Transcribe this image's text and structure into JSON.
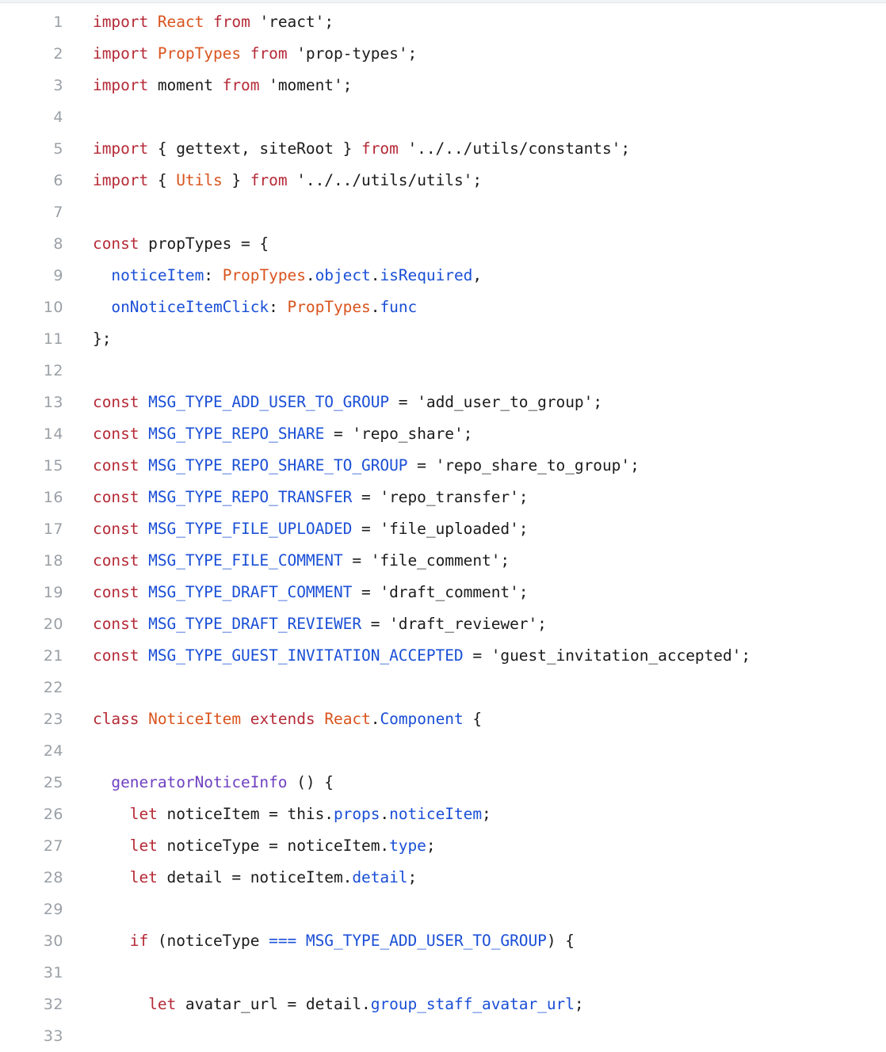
{
  "editor": {
    "language": "javascript",
    "first_line": 1,
    "last_line": 33,
    "total_lines": 33,
    "gutter_color": "#9aa0a6",
    "background_color": "#ffffff",
    "text_color": "#1b1b1b"
  },
  "theme": {
    "keyword": "#b52a37",
    "class_name": "#d9541e",
    "property": "#1a4fd6",
    "function_name": "#6f42c1",
    "string": "#1b1b1b",
    "plain": "#1b1b1b"
  },
  "lines": [
    {
      "n": "1",
      "tokens": [
        {
          "t": "import",
          "c": "tok-kw"
        },
        {
          "t": " ",
          "c": "tok-plain"
        },
        {
          "t": "React",
          "c": "tok-cls"
        },
        {
          "t": " ",
          "c": "tok-plain"
        },
        {
          "t": "from",
          "c": "tok-kw"
        },
        {
          "t": " ",
          "c": "tok-plain"
        },
        {
          "t": "'react'",
          "c": "tok-str"
        },
        {
          "t": ";",
          "c": "tok-punc"
        }
      ]
    },
    {
      "n": "2",
      "tokens": [
        {
          "t": "import",
          "c": "tok-kw"
        },
        {
          "t": " ",
          "c": "tok-plain"
        },
        {
          "t": "PropTypes",
          "c": "tok-cls"
        },
        {
          "t": " ",
          "c": "tok-plain"
        },
        {
          "t": "from",
          "c": "tok-kw"
        },
        {
          "t": " ",
          "c": "tok-plain"
        },
        {
          "t": "'prop-types'",
          "c": "tok-str"
        },
        {
          "t": ";",
          "c": "tok-punc"
        }
      ]
    },
    {
      "n": "3",
      "tokens": [
        {
          "t": "import",
          "c": "tok-kw"
        },
        {
          "t": " moment ",
          "c": "tok-plain"
        },
        {
          "t": "from",
          "c": "tok-kw"
        },
        {
          "t": " ",
          "c": "tok-plain"
        },
        {
          "t": "'moment'",
          "c": "tok-str"
        },
        {
          "t": ";",
          "c": "tok-punc"
        }
      ]
    },
    {
      "n": "4",
      "tokens": []
    },
    {
      "n": "5",
      "tokens": [
        {
          "t": "import",
          "c": "tok-kw"
        },
        {
          "t": " { gettext, siteRoot } ",
          "c": "tok-plain"
        },
        {
          "t": "from",
          "c": "tok-kw"
        },
        {
          "t": " ",
          "c": "tok-plain"
        },
        {
          "t": "'../../utils/constants'",
          "c": "tok-str"
        },
        {
          "t": ";",
          "c": "tok-punc"
        }
      ]
    },
    {
      "n": "6",
      "tokens": [
        {
          "t": "import",
          "c": "tok-kw"
        },
        {
          "t": " { ",
          "c": "tok-plain"
        },
        {
          "t": "Utils",
          "c": "tok-cls"
        },
        {
          "t": " } ",
          "c": "tok-plain"
        },
        {
          "t": "from",
          "c": "tok-kw"
        },
        {
          "t": " ",
          "c": "tok-plain"
        },
        {
          "t": "'../../utils/utils'",
          "c": "tok-str"
        },
        {
          "t": ";",
          "c": "tok-punc"
        }
      ]
    },
    {
      "n": "7",
      "tokens": []
    },
    {
      "n": "8",
      "tokens": [
        {
          "t": "const",
          "c": "tok-kw"
        },
        {
          "t": " propTypes = {",
          "c": "tok-plain"
        }
      ]
    },
    {
      "n": "9",
      "tokens": [
        {
          "t": "  ",
          "c": "tok-plain"
        },
        {
          "t": "noticeItem",
          "c": "tok-prop"
        },
        {
          "t": ": ",
          "c": "tok-punc"
        },
        {
          "t": "PropTypes",
          "c": "tok-cls"
        },
        {
          "t": ".",
          "c": "tok-punc"
        },
        {
          "t": "object",
          "c": "tok-prop"
        },
        {
          "t": ".",
          "c": "tok-punc"
        },
        {
          "t": "isRequired",
          "c": "tok-prop"
        },
        {
          "t": ",",
          "c": "tok-punc"
        }
      ]
    },
    {
      "n": "10",
      "tokens": [
        {
          "t": "  ",
          "c": "tok-plain"
        },
        {
          "t": "onNoticeItemClick",
          "c": "tok-prop"
        },
        {
          "t": ": ",
          "c": "tok-punc"
        },
        {
          "t": "PropTypes",
          "c": "tok-cls"
        },
        {
          "t": ".",
          "c": "tok-punc"
        },
        {
          "t": "func",
          "c": "tok-prop"
        }
      ]
    },
    {
      "n": "11",
      "tokens": [
        {
          "t": "};",
          "c": "tok-plain"
        }
      ]
    },
    {
      "n": "12",
      "tokens": []
    },
    {
      "n": "13",
      "tokens": [
        {
          "t": "const",
          "c": "tok-kw"
        },
        {
          "t": " ",
          "c": "tok-plain"
        },
        {
          "t": "MSG_TYPE_ADD_USER_TO_GROUP",
          "c": "tok-prop"
        },
        {
          "t": " = ",
          "c": "tok-plain"
        },
        {
          "t": "'add_user_to_group'",
          "c": "tok-str"
        },
        {
          "t": ";",
          "c": "tok-punc"
        }
      ]
    },
    {
      "n": "14",
      "tokens": [
        {
          "t": "const",
          "c": "tok-kw"
        },
        {
          "t": " ",
          "c": "tok-plain"
        },
        {
          "t": "MSG_TYPE_REPO_SHARE",
          "c": "tok-prop"
        },
        {
          "t": " = ",
          "c": "tok-plain"
        },
        {
          "t": "'repo_share'",
          "c": "tok-str"
        },
        {
          "t": ";",
          "c": "tok-punc"
        }
      ]
    },
    {
      "n": "15",
      "tokens": [
        {
          "t": "const",
          "c": "tok-kw"
        },
        {
          "t": " ",
          "c": "tok-plain"
        },
        {
          "t": "MSG_TYPE_REPO_SHARE_TO_GROUP",
          "c": "tok-prop"
        },
        {
          "t": " = ",
          "c": "tok-plain"
        },
        {
          "t": "'repo_share_to_group'",
          "c": "tok-str"
        },
        {
          "t": ";",
          "c": "tok-punc"
        }
      ]
    },
    {
      "n": "16",
      "tokens": [
        {
          "t": "const",
          "c": "tok-kw"
        },
        {
          "t": " ",
          "c": "tok-plain"
        },
        {
          "t": "MSG_TYPE_REPO_TRANSFER",
          "c": "tok-prop"
        },
        {
          "t": " = ",
          "c": "tok-plain"
        },
        {
          "t": "'repo_transfer'",
          "c": "tok-str"
        },
        {
          "t": ";",
          "c": "tok-punc"
        }
      ]
    },
    {
      "n": "17",
      "tokens": [
        {
          "t": "const",
          "c": "tok-kw"
        },
        {
          "t": " ",
          "c": "tok-plain"
        },
        {
          "t": "MSG_TYPE_FILE_UPLOADED",
          "c": "tok-prop"
        },
        {
          "t": " = ",
          "c": "tok-plain"
        },
        {
          "t": "'file_uploaded'",
          "c": "tok-str"
        },
        {
          "t": ";",
          "c": "tok-punc"
        }
      ]
    },
    {
      "n": "18",
      "tokens": [
        {
          "t": "const",
          "c": "tok-kw"
        },
        {
          "t": " ",
          "c": "tok-plain"
        },
        {
          "t": "MSG_TYPE_FILE_COMMENT",
          "c": "tok-prop"
        },
        {
          "t": " = ",
          "c": "tok-plain"
        },
        {
          "t": "'file_comment'",
          "c": "tok-str"
        },
        {
          "t": ";",
          "c": "tok-punc"
        }
      ]
    },
    {
      "n": "19",
      "tokens": [
        {
          "t": "const",
          "c": "tok-kw"
        },
        {
          "t": " ",
          "c": "tok-plain"
        },
        {
          "t": "MSG_TYPE_DRAFT_COMMENT",
          "c": "tok-prop"
        },
        {
          "t": " = ",
          "c": "tok-plain"
        },
        {
          "t": "'draft_comment'",
          "c": "tok-str"
        },
        {
          "t": ";",
          "c": "tok-punc"
        }
      ]
    },
    {
      "n": "20",
      "tokens": [
        {
          "t": "const",
          "c": "tok-kw"
        },
        {
          "t": " ",
          "c": "tok-plain"
        },
        {
          "t": "MSG_TYPE_DRAFT_REVIEWER",
          "c": "tok-prop"
        },
        {
          "t": " = ",
          "c": "tok-plain"
        },
        {
          "t": "'draft_reviewer'",
          "c": "tok-str"
        },
        {
          "t": ";",
          "c": "tok-punc"
        }
      ]
    },
    {
      "n": "21",
      "tokens": [
        {
          "t": "const",
          "c": "tok-kw"
        },
        {
          "t": " ",
          "c": "tok-plain"
        },
        {
          "t": "MSG_TYPE_GUEST_INVITATION_ACCEPTED",
          "c": "tok-prop"
        },
        {
          "t": " = ",
          "c": "tok-plain"
        },
        {
          "t": "'guest_invitation_accepted'",
          "c": "tok-str"
        },
        {
          "t": ";",
          "c": "tok-punc"
        }
      ]
    },
    {
      "n": "22",
      "tokens": []
    },
    {
      "n": "23",
      "tokens": [
        {
          "t": "class",
          "c": "tok-kw"
        },
        {
          "t": " ",
          "c": "tok-plain"
        },
        {
          "t": "NoticeItem",
          "c": "tok-cls"
        },
        {
          "t": " ",
          "c": "tok-plain"
        },
        {
          "t": "extends",
          "c": "tok-kw"
        },
        {
          "t": " ",
          "c": "tok-plain"
        },
        {
          "t": "React",
          "c": "tok-cls"
        },
        {
          "t": ".",
          "c": "tok-punc"
        },
        {
          "t": "Component",
          "c": "tok-prop"
        },
        {
          "t": " {",
          "c": "tok-plain"
        }
      ]
    },
    {
      "n": "24",
      "tokens": []
    },
    {
      "n": "25",
      "tokens": [
        {
          "t": "  ",
          "c": "tok-plain"
        },
        {
          "t": "generatorNoticeInfo",
          "c": "tok-fn"
        },
        {
          "t": " () {",
          "c": "tok-plain"
        }
      ]
    },
    {
      "n": "26",
      "tokens": [
        {
          "t": "    ",
          "c": "tok-plain"
        },
        {
          "t": "let",
          "c": "tok-kw"
        },
        {
          "t": " noticeItem = this.",
          "c": "tok-plain"
        },
        {
          "t": "props",
          "c": "tok-prop"
        },
        {
          "t": ".",
          "c": "tok-punc"
        },
        {
          "t": "noticeItem",
          "c": "tok-prop"
        },
        {
          "t": ";",
          "c": "tok-punc"
        }
      ]
    },
    {
      "n": "27",
      "tokens": [
        {
          "t": "    ",
          "c": "tok-plain"
        },
        {
          "t": "let",
          "c": "tok-kw"
        },
        {
          "t": " noticeType = noticeItem.",
          "c": "tok-plain"
        },
        {
          "t": "type",
          "c": "tok-prop"
        },
        {
          "t": ";",
          "c": "tok-punc"
        }
      ]
    },
    {
      "n": "28",
      "tokens": [
        {
          "t": "    ",
          "c": "tok-plain"
        },
        {
          "t": "let",
          "c": "tok-kw"
        },
        {
          "t": " detail = noticeItem.",
          "c": "tok-plain"
        },
        {
          "t": "detail",
          "c": "tok-prop"
        },
        {
          "t": ";",
          "c": "tok-punc"
        }
      ]
    },
    {
      "n": "29",
      "tokens": []
    },
    {
      "n": "30",
      "tokens": [
        {
          "t": "    ",
          "c": "tok-plain"
        },
        {
          "t": "if",
          "c": "tok-kw"
        },
        {
          "t": " (noticeType ",
          "c": "tok-plain"
        },
        {
          "t": "===",
          "c": "tok-prop"
        },
        {
          "t": " ",
          "c": "tok-plain"
        },
        {
          "t": "MSG_TYPE_ADD_USER_TO_GROUP",
          "c": "tok-prop"
        },
        {
          "t": ") {",
          "c": "tok-plain"
        }
      ]
    },
    {
      "n": "31",
      "tokens": []
    },
    {
      "n": "32",
      "tokens": [
        {
          "t": "      ",
          "c": "tok-plain"
        },
        {
          "t": "let",
          "c": "tok-kw"
        },
        {
          "t": " avatar_url = detail.",
          "c": "tok-plain"
        },
        {
          "t": "group_staff_avatar_url",
          "c": "tok-prop"
        },
        {
          "t": ";",
          "c": "tok-punc"
        }
      ]
    },
    {
      "n": "33",
      "tokens": []
    }
  ]
}
